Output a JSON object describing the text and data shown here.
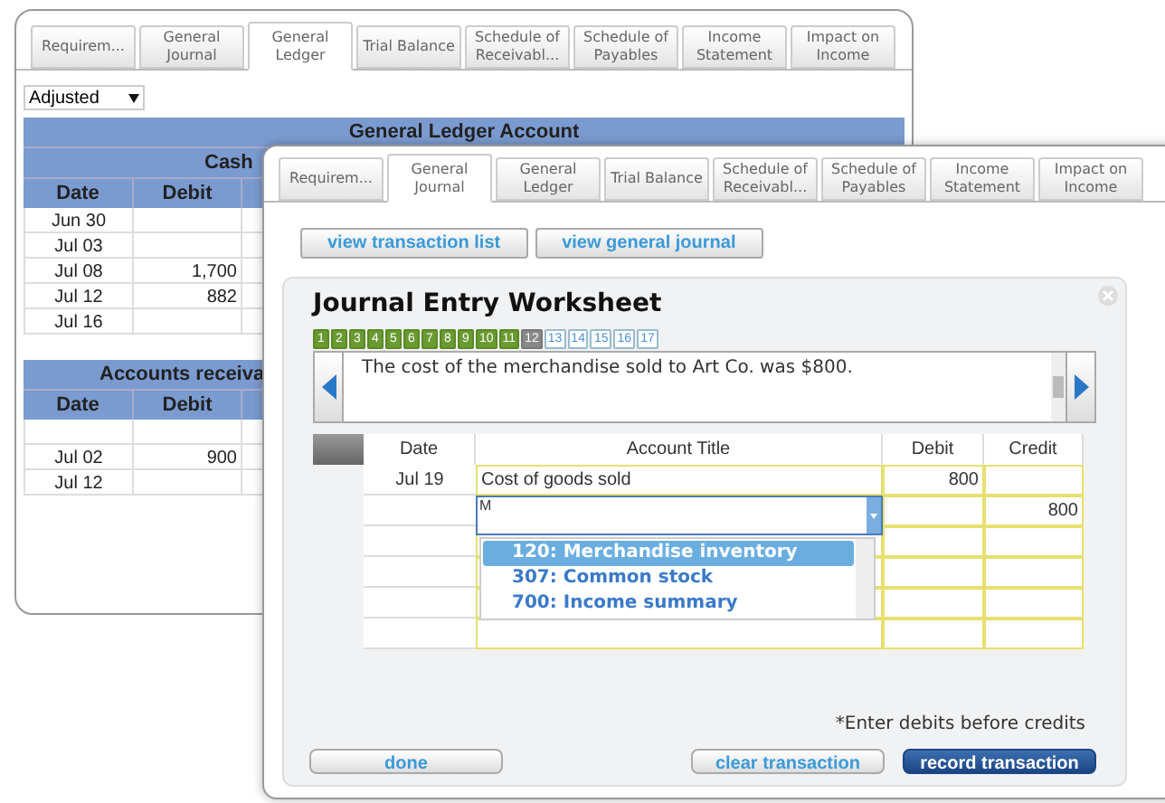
{
  "back_window": {
    "tabs": [
      {
        "label": "Requirem...",
        "selected": false
      },
      {
        "label": "General Journal",
        "selected": false
      },
      {
        "label": "General Ledger",
        "selected": true
      },
      {
        "label": "Trial Balance",
        "selected": false
      },
      {
        "label": "Schedule of Receivabl...",
        "selected": false
      },
      {
        "label": "Schedule of Payables",
        "selected": false
      },
      {
        "label": "Income Statement",
        "selected": false
      },
      {
        "label": "Impact on Income",
        "selected": false
      }
    ],
    "view_select": {
      "value": "Adjusted"
    },
    "title": "General Ledger Account",
    "accounts": [
      {
        "name": "Cash",
        "columns": [
          "Date",
          "Debit"
        ],
        "rows": [
          {
            "date": "Jun 30",
            "debit": ""
          },
          {
            "date": "Jul 03",
            "debit": ""
          },
          {
            "date": "Jul 08",
            "debit": "1,700"
          },
          {
            "date": "Jul 12",
            "debit": "882"
          },
          {
            "date": "Jul 16",
            "debit": ""
          }
        ]
      },
      {
        "name": "Accounts receiva",
        "columns": [
          "Date",
          "Debit"
        ],
        "rows": [
          {
            "date": "",
            "debit": ""
          },
          {
            "date": "Jul 02",
            "debit": "900"
          },
          {
            "date": "Jul 12",
            "debit": ""
          }
        ]
      }
    ]
  },
  "front_window": {
    "tabs": [
      {
        "label": "Requirem...",
        "selected": false
      },
      {
        "label": "General Journal",
        "selected": true
      },
      {
        "label": "General Ledger",
        "selected": false
      },
      {
        "label": "Trial Balance",
        "selected": false
      },
      {
        "label": "Schedule of Receivabl...",
        "selected": false
      },
      {
        "label": "Schedule of Payables",
        "selected": false
      },
      {
        "label": "Income Statement",
        "selected": false
      },
      {
        "label": "Impact on Income",
        "selected": false
      }
    ],
    "buttons": [
      "view transaction list",
      "view general journal"
    ],
    "worksheet": {
      "title": "Journal Entry Worksheet",
      "steps": [
        {
          "label": "1",
          "completed": true,
          "selected": false
        },
        {
          "label": "2",
          "completed": true,
          "selected": false
        },
        {
          "label": "3",
          "completed": true,
          "selected": false
        },
        {
          "label": "4",
          "completed": true,
          "selected": false
        },
        {
          "label": "5",
          "completed": true,
          "selected": false
        },
        {
          "label": "6",
          "completed": true,
          "selected": false
        },
        {
          "label": "7",
          "completed": true,
          "selected": false
        },
        {
          "label": "8",
          "completed": true,
          "selected": false
        },
        {
          "label": "9",
          "completed": true,
          "selected": false
        },
        {
          "label": "10",
          "completed": true,
          "selected": false
        },
        {
          "label": "11",
          "completed": true,
          "selected": false
        },
        {
          "label": "12",
          "completed": false,
          "selected": true
        },
        {
          "label": "13",
          "completed": false,
          "selected": false
        },
        {
          "label": "14",
          "completed": false,
          "selected": false
        },
        {
          "label": "15",
          "completed": false,
          "selected": false
        },
        {
          "label": "16",
          "completed": false,
          "selected": false
        },
        {
          "label": "17",
          "completed": false,
          "selected": false
        }
      ],
      "description": "The cost of the merchandise sold to Art Co. was $800.",
      "columns": [
        "Date",
        "Account Title",
        "Debit",
        "Credit"
      ],
      "rows": [
        {
          "date": "Jul 19",
          "account": "Cost of goods sold",
          "debit": "800",
          "credit": "",
          "editing": false
        },
        {
          "date": "",
          "account": "M",
          "debit": "",
          "credit": "800",
          "editing": true
        },
        {
          "date": "",
          "account": "",
          "debit": "",
          "credit": "",
          "editing": false
        },
        {
          "date": "",
          "account": "",
          "debit": "",
          "credit": "",
          "editing": false
        },
        {
          "date": "",
          "account": "",
          "debit": "",
          "credit": "",
          "editing": false
        },
        {
          "date": "",
          "account": "",
          "debit": "",
          "credit": "",
          "editing": false
        }
      ],
      "options": [
        {
          "label": "120: Merchandise inventory",
          "selected": true
        },
        {
          "label": "307: Common stock",
          "selected": false
        },
        {
          "label": "700: Income summary",
          "selected": false
        }
      ],
      "note": "*Enter debits before credits",
      "buttons": [
        {
          "label": "done",
          "kind": "secondary"
        },
        {
          "label": "clear transaction",
          "kind": "secondary"
        },
        {
          "label": "record transaction",
          "kind": "primary"
        }
      ]
    }
  }
}
